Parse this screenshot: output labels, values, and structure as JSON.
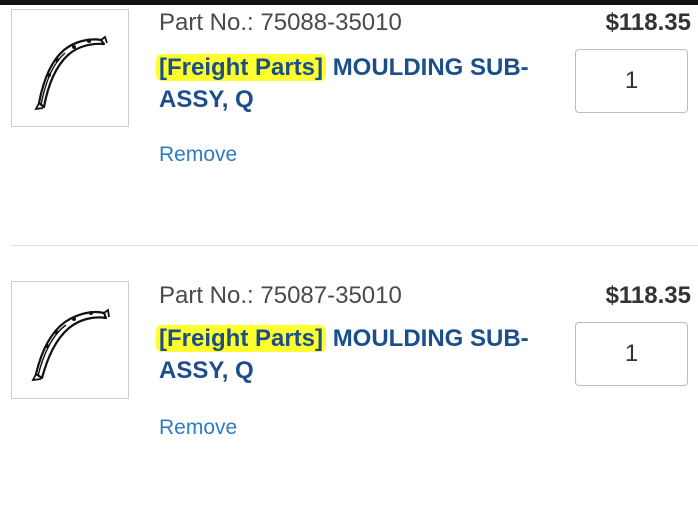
{
  "cart": {
    "items": [
      {
        "part_label": "Part No.:",
        "part_number": "75088-35010",
        "price": "$118.35",
        "tag": "[Freight Parts]",
        "name": "MOULDING SUB-ASSY, Q",
        "quantity": "1",
        "remove_label": "Remove",
        "thumbnail_icon": "fender-moulding-icon"
      },
      {
        "part_label": "Part No.:",
        "part_number": "75087-35010",
        "price": "$118.35",
        "tag": "[Freight Parts]",
        "name": "MOULDING SUB-ASSY, Q",
        "quantity": "1",
        "remove_label": "Remove",
        "thumbnail_icon": "fender-moulding-icon"
      }
    ]
  },
  "colors": {
    "title_blue": "#1a4f8b",
    "link_blue": "#2f7bc4",
    "highlight_yellow": "#ffff2e",
    "price_text": "#333333"
  }
}
